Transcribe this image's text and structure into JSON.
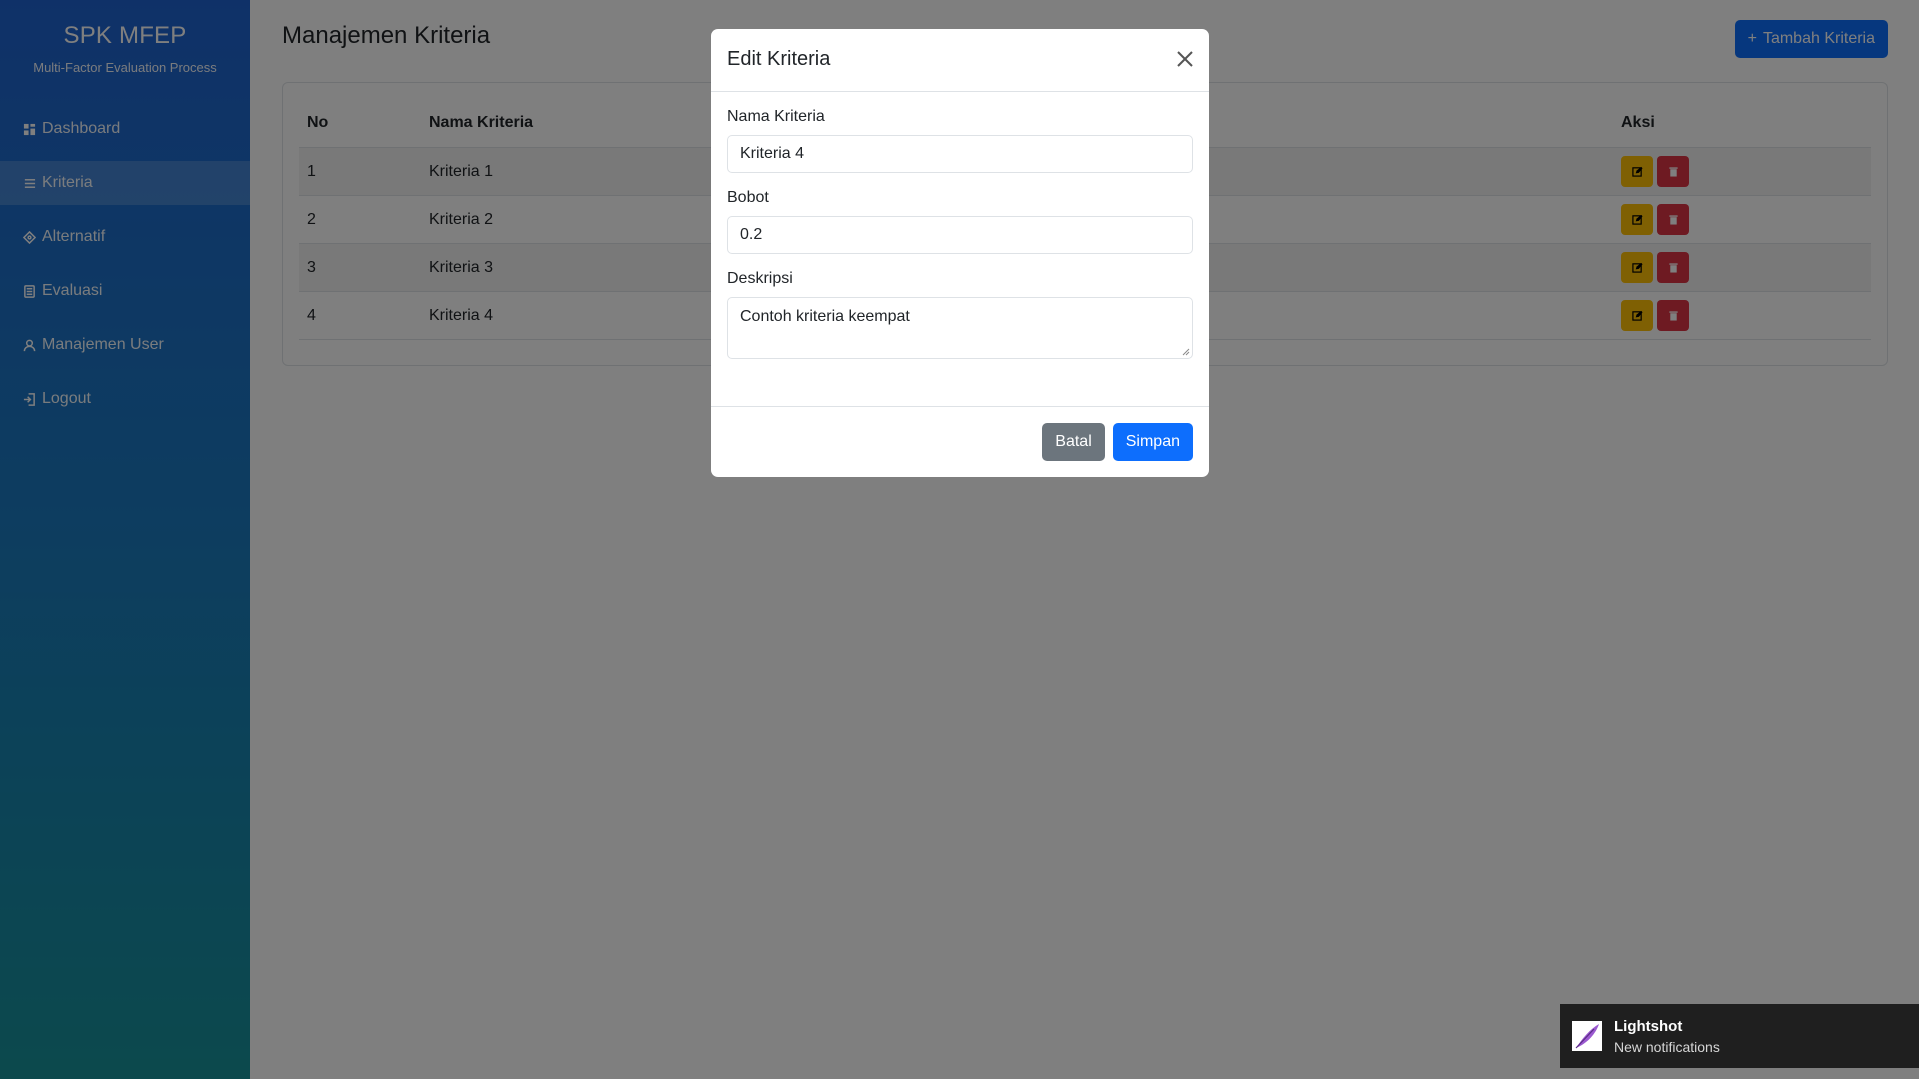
{
  "brand": {
    "title": "SPK MFEP",
    "subtitle": "Multi-Factor Evaluation Process"
  },
  "sidebar": {
    "items": [
      {
        "label": "Dashboard",
        "icon": "grid-icon"
      },
      {
        "label": "Kriteria",
        "icon": "list-icon",
        "active": true
      },
      {
        "label": "Alternatif",
        "icon": "diamond-icon"
      },
      {
        "label": "Evaluasi",
        "icon": "calculator-icon"
      },
      {
        "label": "Manajemen User",
        "icon": "user-icon"
      },
      {
        "label": "Logout",
        "icon": "logout-icon"
      }
    ]
  },
  "main": {
    "title": "Manajemen Kriteria",
    "add_button": "Tambah Kriteria",
    "table": {
      "headers": {
        "no": "No",
        "nama": "Nama Kriteria",
        "aksi": "Aksi"
      },
      "rows": [
        {
          "no": "1",
          "nama": "Kriteria 1"
        },
        {
          "no": "2",
          "nama": "Kriteria 2"
        },
        {
          "no": "3",
          "nama": "Kriteria 3"
        },
        {
          "no": "4",
          "nama": "Kriteria 4"
        }
      ]
    }
  },
  "modal": {
    "title": "Edit Kriteria",
    "nama_label": "Nama Kriteria",
    "nama_value": "Kriteria 4",
    "bobot_label": "Bobot",
    "bobot_value": "0.2",
    "deskripsi_label": "Deskripsi",
    "deskripsi_value": "Contoh kriteria keempat",
    "cancel": "Batal",
    "save": "Simpan"
  },
  "toast": {
    "title": "Lightshot",
    "text": "New notifications"
  },
  "colors": {
    "primary": "#0d6efd",
    "warning": "#ffc107",
    "danger": "#dc3545",
    "secondary": "#6c757d"
  }
}
